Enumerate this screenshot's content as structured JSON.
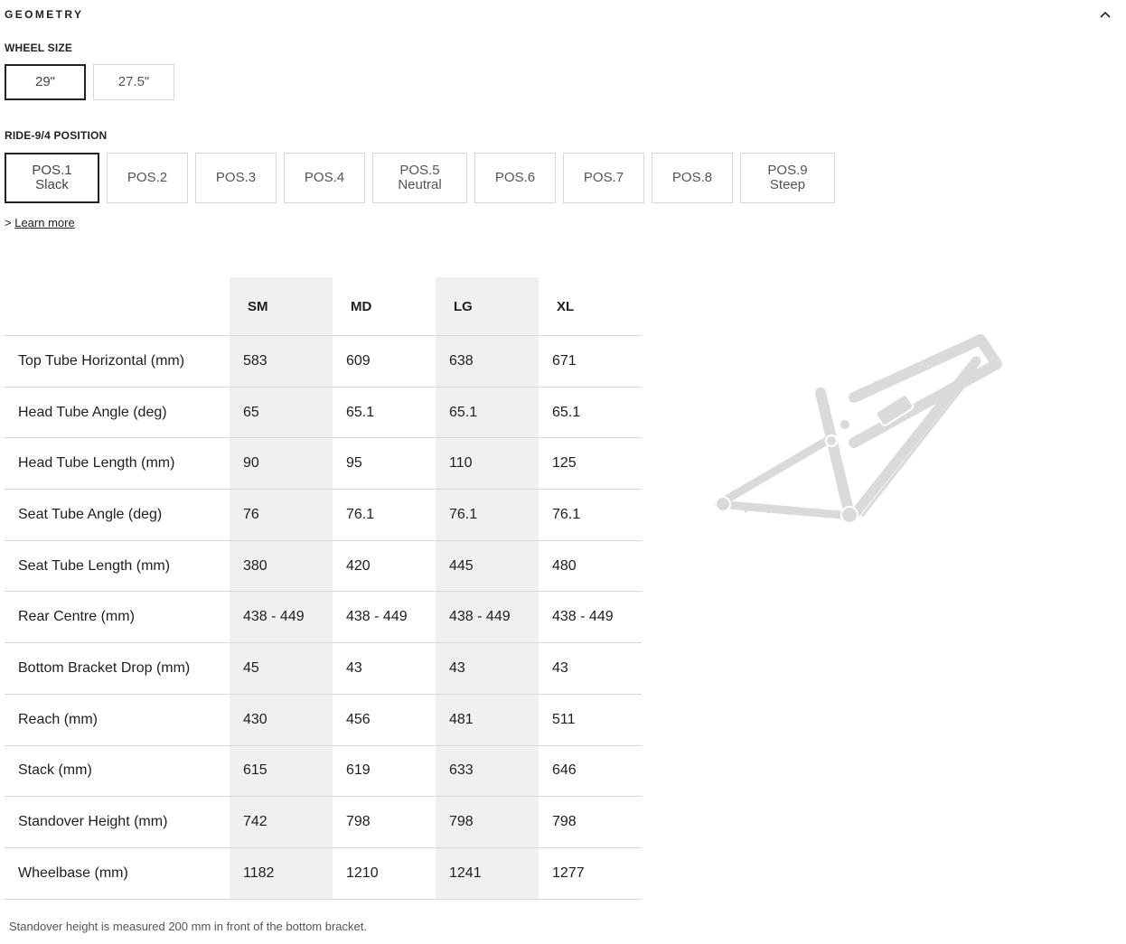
{
  "section": {
    "title": "GEOMETRY"
  },
  "wheel_size": {
    "label": "WHEEL SIZE",
    "options": [
      "29\"",
      "27.5\""
    ],
    "selected": "29\""
  },
  "position": {
    "label": "RIDE-9/4 POSITION",
    "options": [
      {
        "line1": "POS.1",
        "line2": "Slack"
      },
      {
        "line1": "POS.2",
        "line2": ""
      },
      {
        "line1": "POS.3",
        "line2": ""
      },
      {
        "line1": "POS.4",
        "line2": ""
      },
      {
        "line1": "POS.5",
        "line2": "Neutral"
      },
      {
        "line1": "POS.6",
        "line2": ""
      },
      {
        "line1": "POS.7",
        "line2": ""
      },
      {
        "line1": "POS.8",
        "line2": ""
      },
      {
        "line1": "POS.9",
        "line2": "Steep"
      }
    ],
    "selected": "POS.1"
  },
  "learn_more": {
    "prefix": ">",
    "text": "Learn more"
  },
  "table": {
    "columns": [
      "SM",
      "MD",
      "LG",
      "XL"
    ],
    "rows": [
      {
        "label": "Top Tube Horizontal (mm)",
        "values": [
          "583",
          "609",
          "638",
          "671"
        ]
      },
      {
        "label": "Head Tube Angle (deg)",
        "values": [
          "65",
          "65.1",
          "65.1",
          "65.1"
        ]
      },
      {
        "label": "Head Tube Length (mm)",
        "values": [
          "90",
          "95",
          "110",
          "125"
        ]
      },
      {
        "label": "Seat Tube Angle (deg)",
        "values": [
          "76",
          "76.1",
          "76.1",
          "76.1"
        ]
      },
      {
        "label": "Seat Tube Length (mm)",
        "values": [
          "380",
          "420",
          "445",
          "480"
        ]
      },
      {
        "label": "Rear Centre (mm)",
        "values": [
          "438 - 449",
          "438 - 449",
          "438 - 449",
          "438 - 449"
        ]
      },
      {
        "label": "Bottom Bracket Drop (mm)",
        "values": [
          "45",
          "43",
          "43",
          "43"
        ]
      },
      {
        "label": "Reach (mm)",
        "values": [
          "430",
          "456",
          "481",
          "511"
        ]
      },
      {
        "label": "Stack (mm)",
        "values": [
          "615",
          "619",
          "633",
          "646"
        ]
      },
      {
        "label": "Standover Height (mm)",
        "values": [
          "742",
          "798",
          "798",
          "798"
        ]
      },
      {
        "label": "Wheelbase (mm)",
        "values": [
          "1182",
          "1210",
          "1241",
          "1277"
        ]
      }
    ]
  },
  "footnote": "Standover height is measured 200 mm in front of the bottom bracket.",
  "colors": {
    "band": "#f0f0f0",
    "border": "#d9d9d9",
    "active_border": "#222222",
    "frame": "#d9d9d9"
  }
}
